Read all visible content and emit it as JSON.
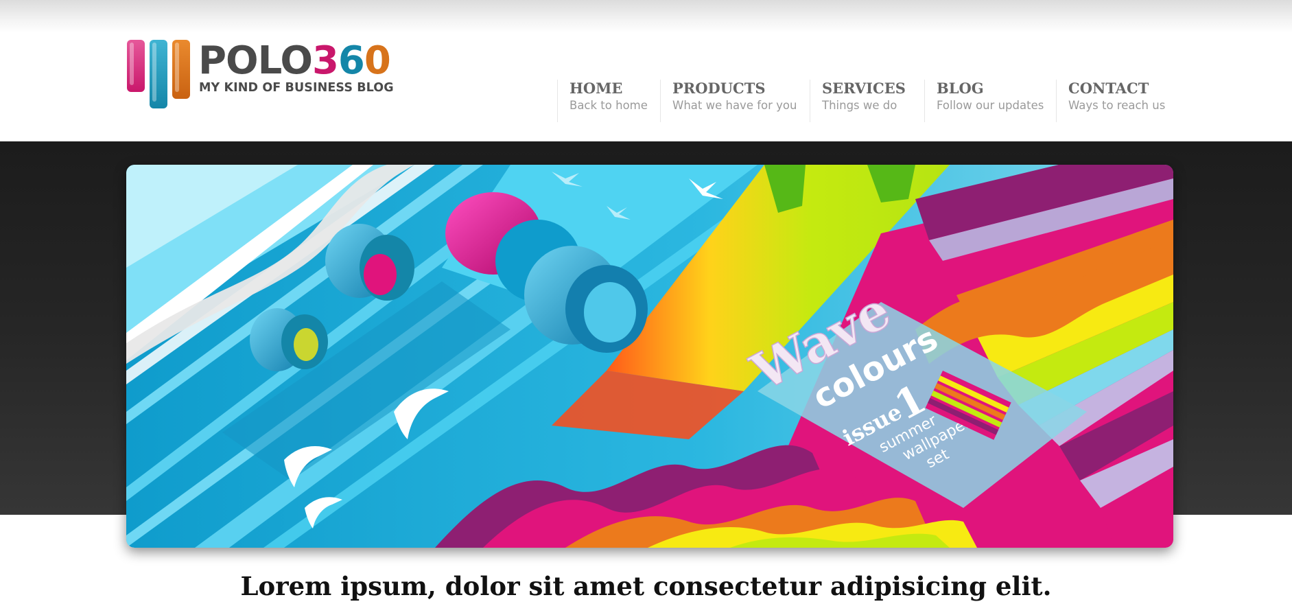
{
  "logo": {
    "name_prefix": "POLO",
    "name_digit_1": "3",
    "name_digit_2": "6",
    "name_digit_3": "0",
    "tagline": "MY KIND OF BUSINESS BLOG",
    "colors": {
      "text": "#4a4a4a",
      "pink": "#c9176b",
      "blue": "#1486a8",
      "orange": "#d7731b"
    }
  },
  "nav": {
    "items": [
      {
        "title": "HOME",
        "subtitle": "Back to home"
      },
      {
        "title": "PRODUCTS",
        "subtitle": "What we have for you"
      },
      {
        "title": "SERVICES",
        "subtitle": "Things we do"
      },
      {
        "title": "BLOG",
        "subtitle": "Follow our updates"
      },
      {
        "title": "CONTACT",
        "subtitle": "Ways to reach us"
      }
    ]
  },
  "hero": {
    "art_text_1": "Wave",
    "art_text_2": "colours",
    "art_text_3": "issue",
    "art_text_4": "1",
    "art_text_5": "summer",
    "art_text_6": "wallpaper",
    "art_text_7": "set",
    "colors": {
      "cyan": "#4fd3f2",
      "blue": "#0f9ccc",
      "magenta": "#e0147c",
      "purple": "#8e1f72",
      "lime": "#c4ea10",
      "yellow": "#f7ea12",
      "orange": "#ec7a1c"
    }
  },
  "main": {
    "headline": "Lorem ipsum, dolor sit amet consectetur adipisicing elit."
  }
}
